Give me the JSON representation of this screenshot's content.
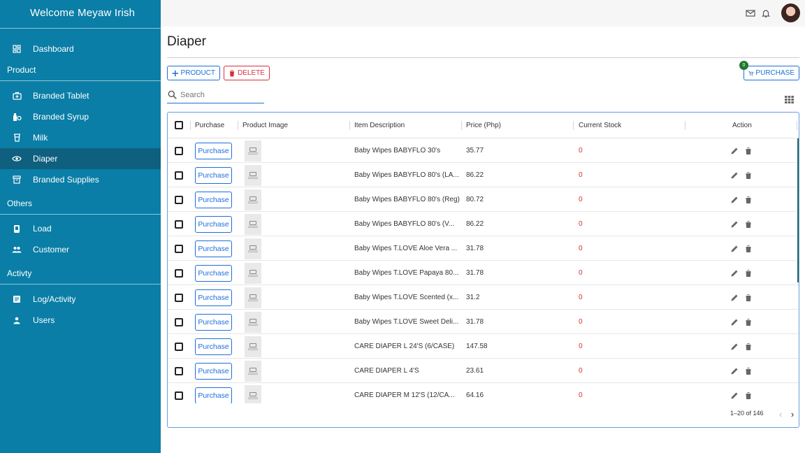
{
  "sidebar": {
    "welcome": "Welcome  Meyaw Irish",
    "dashboard": {
      "label": "Dashboard",
      "icon": "dashboard-icon"
    },
    "sections": [
      {
        "title": "Product",
        "items": [
          {
            "label": "Branded Tablet",
            "icon": "medical-bag-icon"
          },
          {
            "label": "Branded Syrup",
            "icon": "syrup-icon"
          },
          {
            "label": "Milk",
            "icon": "milk-icon"
          },
          {
            "label": "Diaper",
            "icon": "eye-icon",
            "active": true
          },
          {
            "label": "Branded Supplies",
            "icon": "archive-icon"
          }
        ]
      },
      {
        "title": "Others",
        "items": [
          {
            "label": "Load",
            "icon": "phone-icon"
          },
          {
            "label": "Customer",
            "icon": "people-icon"
          }
        ]
      },
      {
        "title": "Activty",
        "items": [
          {
            "label": "Log/Activity",
            "icon": "activity-log-icon"
          },
          {
            "label": "Users",
            "icon": "user-icon"
          }
        ]
      }
    ]
  },
  "topbar": {
    "icons": [
      "mail-icon",
      "bell-icon",
      "avatar"
    ]
  },
  "page": {
    "title": "Diaper",
    "add_product_label": "PRODUCT",
    "delete_label": "DELETE",
    "purchase_label": "PURCHASE",
    "cart_count": "0",
    "search_placeholder": "Search"
  },
  "table": {
    "headers": {
      "purchase": "Purchase",
      "image": "Product Image",
      "description": "Item Description",
      "price": "Price (Php)",
      "stock": "Current Stock",
      "action": "Action"
    },
    "purchase_button_label": "Purchase",
    "rows": [
      {
        "description": "Baby Wipes BABYFLO 30's",
        "price": "35.77",
        "stock": "0"
      },
      {
        "description": "Baby Wipes BABYFLO 80's (LA...",
        "price": "86.22",
        "stock": "0"
      },
      {
        "description": "Baby Wipes BABYFLO 80's (Reg)",
        "price": "80.72",
        "stock": "0"
      },
      {
        "description": "Baby Wipes BABYFLO 80's (V...",
        "price": "86.22",
        "stock": "0"
      },
      {
        "description": "Baby Wipes T.LOVE Aloe Vera ...",
        "price": "31.78",
        "stock": "0"
      },
      {
        "description": "Baby Wipes T.LOVE Papaya 80...",
        "price": "31.78",
        "stock": "0"
      },
      {
        "description": "Baby Wipes T.LOVE Scented (x...",
        "price": "31.2",
        "stock": "0"
      },
      {
        "description": "Baby Wipes T.LOVE Sweet Deli...",
        "price": "31.78",
        "stock": "0"
      },
      {
        "description": "CARE DIAPER L 24'S (6/CASE)",
        "price": "147.58",
        "stock": "0"
      },
      {
        "description": "CARE DIAPER L 4'S",
        "price": "23.61",
        "stock": "0"
      },
      {
        "description": "CARE DIAPER M 12'S (12/CA...",
        "price": "64.16",
        "stock": "0"
      }
    ],
    "pagination": "1–20 of 146"
  },
  "colors": {
    "sidebar": "#0a7ea6",
    "sidebar_active": "#0f5f7f",
    "primary": "#1e6fd9",
    "danger": "#d8303a",
    "stock": "#d32f2f"
  }
}
